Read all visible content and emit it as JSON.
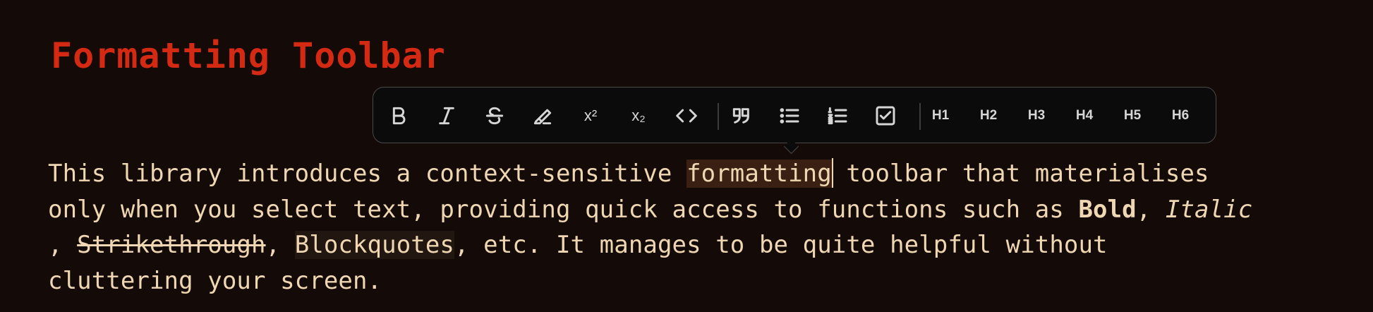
{
  "title": "Formatting Toolbar",
  "toolbar": {
    "buttons": [
      {
        "name": "bold-icon",
        "label": "Bold"
      },
      {
        "name": "italic-icon",
        "label": "Italic"
      },
      {
        "name": "strikethrough-icon",
        "label": "Strikethrough"
      },
      {
        "name": "highlight-icon",
        "label": "Highlight"
      },
      {
        "name": "superscript-icon",
        "label": "Superscript"
      },
      {
        "name": "subscript-icon",
        "label": "Subscript"
      },
      {
        "name": "code-icon",
        "label": "Code"
      },
      {
        "name": "blockquote-icon",
        "label": "Blockquote"
      },
      {
        "name": "bullet-list-icon",
        "label": "Bullet list"
      },
      {
        "name": "numbered-list-icon",
        "label": "Numbered list"
      },
      {
        "name": "task-list-icon",
        "label": "Task list"
      }
    ],
    "superscript_glyph": "x²",
    "subscript_glyph": "x₂",
    "headings": [
      "H1",
      "H2",
      "H3",
      "H4",
      "H5",
      "H6"
    ]
  },
  "paragraph": {
    "l1_before": "This library introduces a context-sensitive ",
    "l1_selected": "formatting",
    "l1_after": " toolbar that materialises",
    "l2_before": "only when you select text, providing quick access to functions such as ",
    "l2_bold": "Bold",
    "l2_sep": ", ",
    "l2_italic": "Italic",
    "l3_lead": ", ",
    "l3_strike": "Strikethrough",
    "l3_sep": ", ",
    "l3_code": "Blockquotes",
    "l3_after": ", etc. It manages to be quite helpful without",
    "l4": "cluttering your screen."
  }
}
